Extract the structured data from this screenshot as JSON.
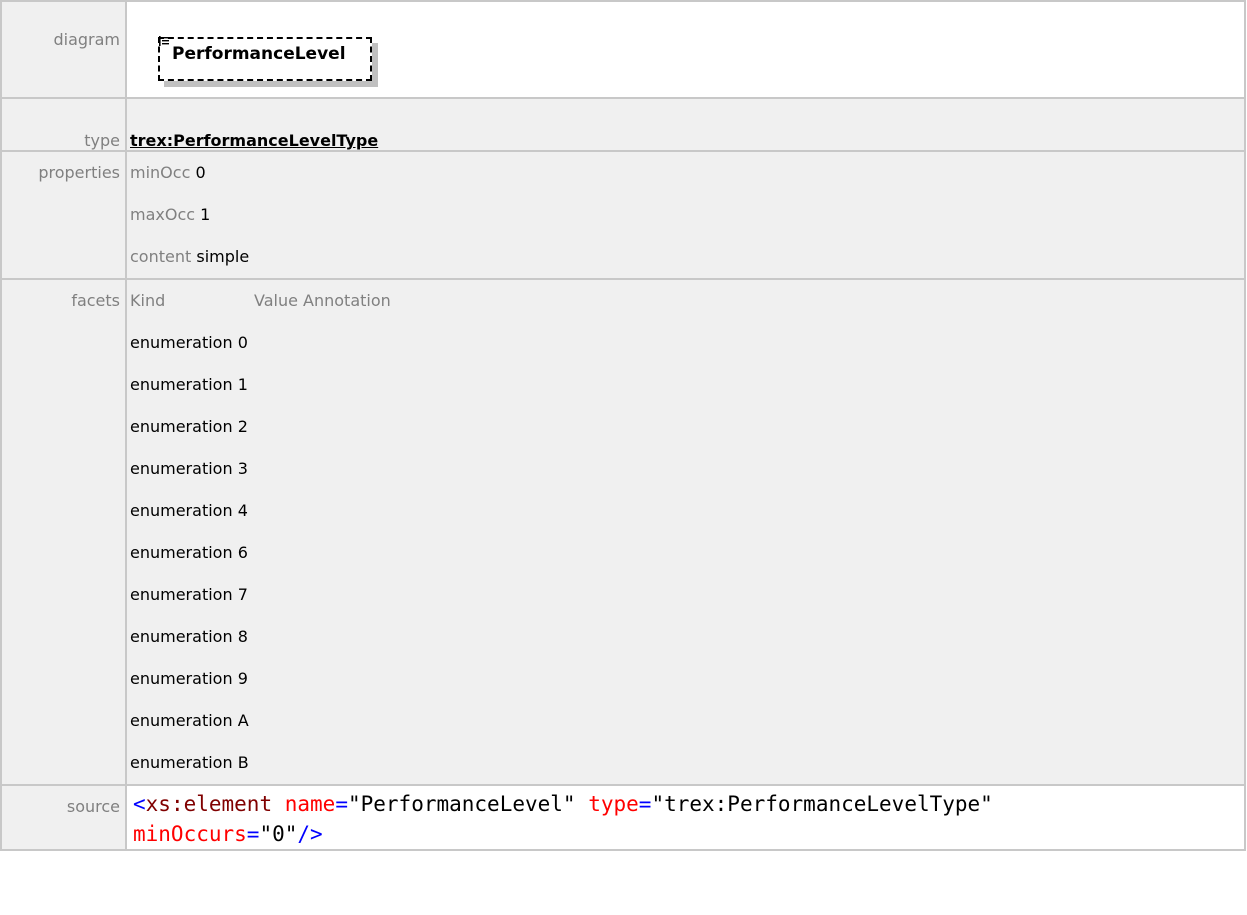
{
  "rows": {
    "diagram": {
      "label": "diagram",
      "element_name": "PerformanceLevel"
    },
    "type": {
      "label": "type",
      "value": "trex:PerformanceLevelType"
    },
    "properties": {
      "label": "properties",
      "items": [
        {
          "key": "minOcc",
          "value": "0"
        },
        {
          "key": "maxOcc",
          "value": "1"
        },
        {
          "key": "content",
          "value": "simple"
        }
      ]
    },
    "facets": {
      "label": "facets",
      "header": {
        "kind": "Kind",
        "value_annotation": "Value Annotation"
      },
      "items": [
        {
          "kind": "enumeration",
          "value": "0"
        },
        {
          "kind": "enumeration",
          "value": "1"
        },
        {
          "kind": "enumeration",
          "value": "2"
        },
        {
          "kind": "enumeration",
          "value": "3"
        },
        {
          "kind": "enumeration",
          "value": "4"
        },
        {
          "kind": "enumeration",
          "value": "6"
        },
        {
          "kind": "enumeration",
          "value": "7"
        },
        {
          "kind": "enumeration",
          "value": "8"
        },
        {
          "kind": "enumeration",
          "value": "9"
        },
        {
          "kind": "enumeration",
          "value": "A"
        },
        {
          "kind": "enumeration",
          "value": "B"
        }
      ]
    },
    "source": {
      "label": "source",
      "open": "<",
      "tag": "xs:element",
      "attr1_name": "name",
      "eq": "=",
      "attr1_value": "\"PerformanceLevel\"",
      "attr2_name": "type",
      "attr2_value": "\"trex:PerformanceLevelType\"",
      "attr3_name": "minOccurs",
      "attr3_value": "\"0\"",
      "close": "/>"
    }
  },
  "icons": {
    "diagram_element": "element-list-icon"
  },
  "colors": {
    "label_gray": "#808080",
    "cell_bg": "#f0f0f0",
    "border": "#c8c8c8",
    "xml_tag": "#800000",
    "xml_attr": "#ff0000",
    "xml_punct": "#0000ff"
  }
}
